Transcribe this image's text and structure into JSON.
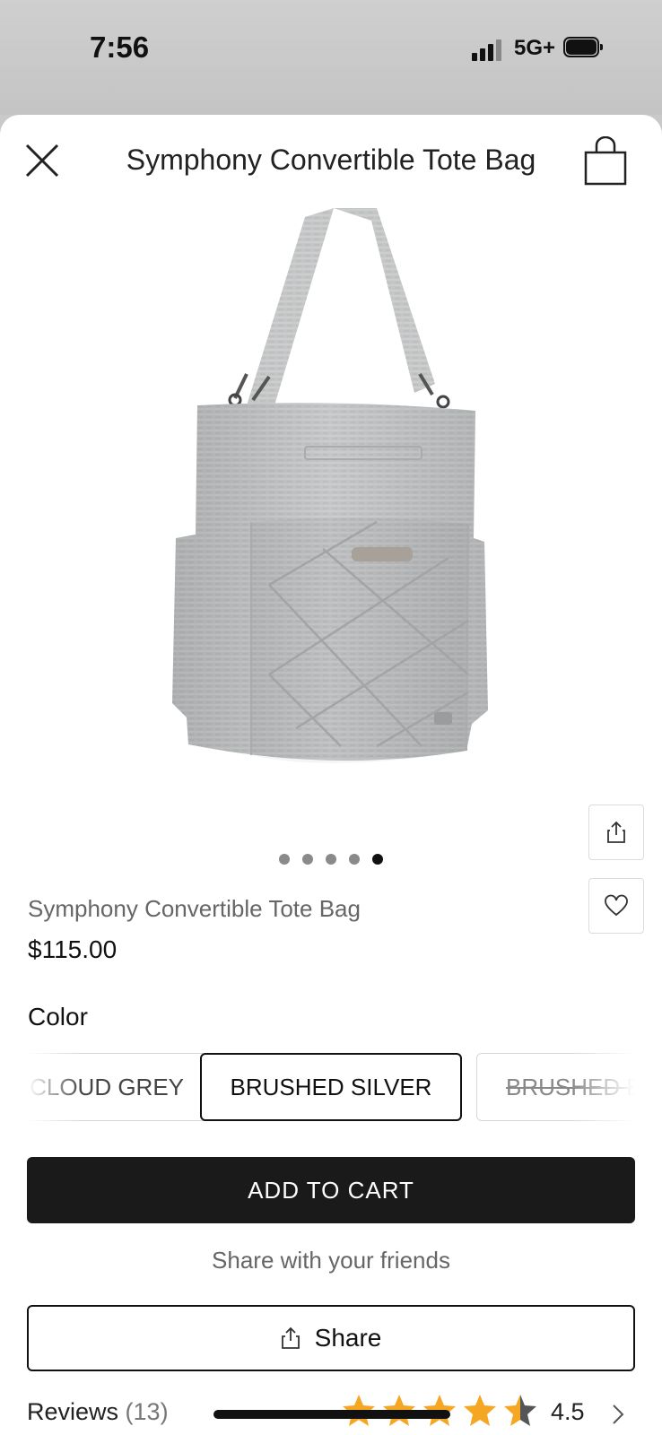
{
  "status_bar": {
    "time": "7:56",
    "network": "5G+"
  },
  "header": {
    "title": "Symphony Convertible Tote Bag"
  },
  "icons": {
    "close": "close-icon",
    "bag": "shopping-bag-icon",
    "share": "share-icon",
    "heart": "heart-icon",
    "chevron": "chevron-right-icon",
    "star": "star-icon"
  },
  "carousel": {
    "dot_count": 5,
    "active_index": 4
  },
  "product": {
    "name": "Symphony Convertible Tote Bag",
    "price": "$115.00"
  },
  "color": {
    "label": "Color",
    "options": [
      {
        "label": "CLOUD GREY",
        "selected": false,
        "available": true
      },
      {
        "label": "BRUSHED SILVER",
        "selected": true,
        "available": true
      },
      {
        "label": "BRUSHED B",
        "selected": false,
        "available": false
      }
    ]
  },
  "cart": {
    "add_label": "ADD TO CART"
  },
  "share": {
    "prompt": "Share with your friends",
    "button_label": "Share"
  },
  "reviews": {
    "label": "Reviews",
    "count": "(13)",
    "rating": "4.5",
    "rating_value": 4.5,
    "max_rating": 5
  },
  "colors": {
    "accent": "#1a1a1a",
    "star": "#f5a623",
    "star_empty": "#555555"
  }
}
